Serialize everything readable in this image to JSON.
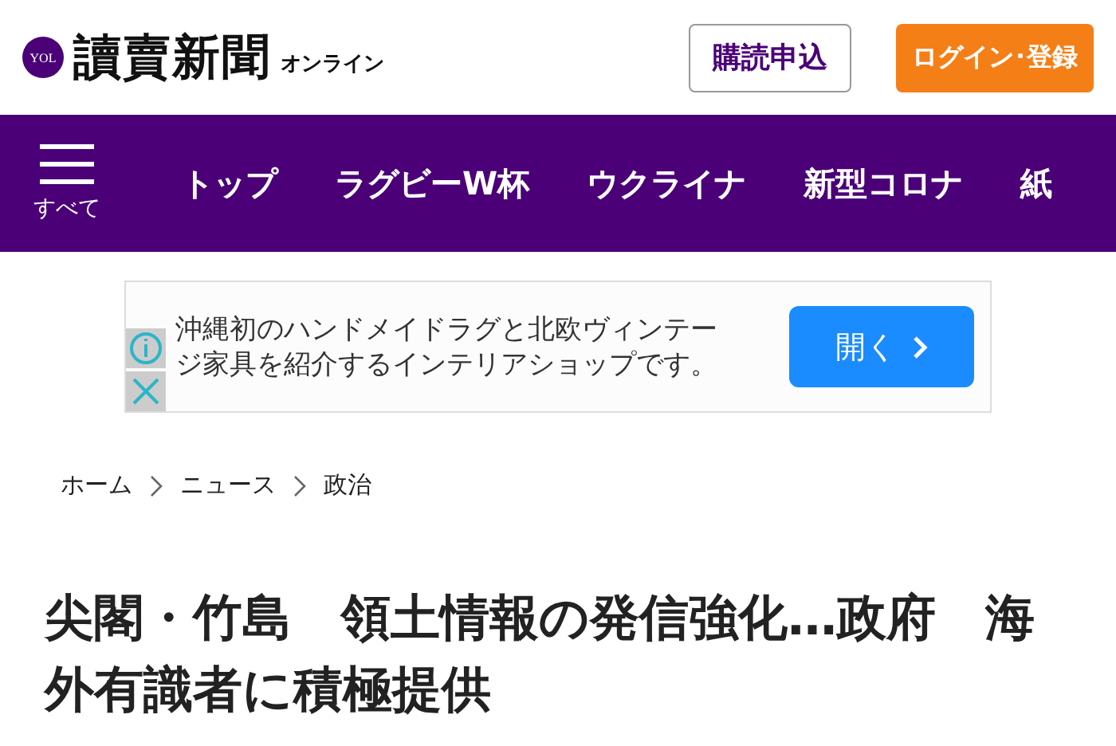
{
  "header": {
    "logo_badge": "YOL",
    "logo": "讀賣新聞",
    "logo_sub": "オンライン",
    "subscribe_button": "購読申込",
    "login_button": "ログイン･登録"
  },
  "nav": {
    "menu_label": "すべて",
    "items": [
      {
        "label": "トップ"
      },
      {
        "label": "ラグビーW杯"
      },
      {
        "label": "ウクライナ"
      },
      {
        "label": "新型コロナ"
      },
      {
        "label": "紙"
      }
    ]
  },
  "ad": {
    "text": "沖縄初のハンドメイドラグと北欧ヴィンテージ家具を紹介するインテリアショップです。",
    "button": "開く"
  },
  "breadcrumb": [
    "ホーム",
    "ニュース",
    "政治"
  ],
  "headline": "尖閣・竹島　領土情報の発信強化…政府　海外有識者に積極提供"
}
